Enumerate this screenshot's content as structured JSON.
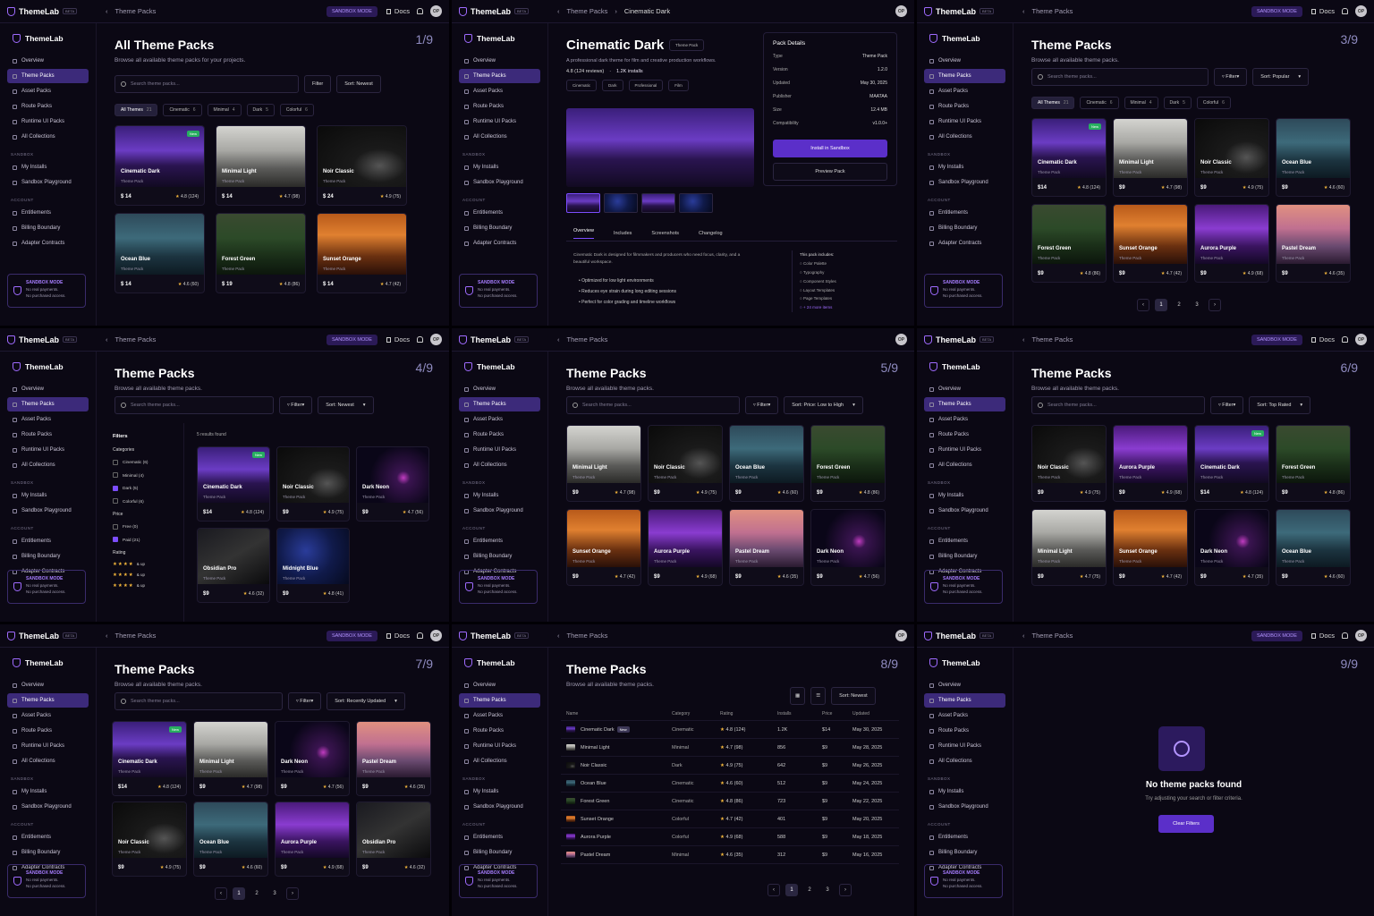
{
  "app": {
    "name": "ThemeLab",
    "beta": "BETA",
    "sandbox_mode": "SANDBOX MODE",
    "docs": "Docs",
    "avatar": "OP",
    "crumb_theme_packs": "Theme Packs",
    "crumb_detail": "Cinematic Dark"
  },
  "sidebar": {
    "overview": "Overview",
    "theme_packs": "Theme Packs",
    "asset_packs": "Asset Packs",
    "route_packs": "Route Packs",
    "runtime_ui": "Runtime UI Packs",
    "all_collections": "All Collections",
    "sandbox_section": "SANDBOX",
    "my_installs": "My Installs",
    "sandbox_playground": "Sandbox Playground",
    "account_section": "ACCOUNT",
    "entitlements": "Entitlements",
    "billing": "Billing Boundary",
    "adapters": "Adapter Contracts",
    "card_title": "SANDBOX MODE",
    "card_line1": "No real payments.",
    "card_line2": "No purchased access."
  },
  "colors": {
    "accent": "#7c4dff",
    "bg": "#0b0814",
    "star": "#f5b73b"
  },
  "p1": {
    "num": "1/9",
    "title": "All Theme Packs",
    "sub": "Browse all available theme packs for your projects.",
    "search": "Search theme packs...",
    "filter": "Filter",
    "sort": "Sort: Newest",
    "chips": [
      {
        "l": "All Themes",
        "c": "21"
      },
      {
        "l": "Cinematic",
        "c": "6"
      },
      {
        "l": "Minimal",
        "c": "4"
      },
      {
        "l": "Dark",
        "c": "5"
      },
      {
        "l": "Colorful",
        "c": "6"
      }
    ],
    "cards": [
      {
        "t": "Cinematic Dark",
        "tp": "Theme Pack",
        "p": "$ 14",
        "r": "4.8 (124)",
        "n": "New"
      },
      {
        "t": "Minimal Light",
        "tp": "Theme Pack",
        "p": "$ 14",
        "r": "4.7 (98)"
      },
      {
        "t": "Noir Classic",
        "tp": "Theme Pack",
        "p": "$ 24",
        "r": "4.9 (75)"
      },
      {
        "t": "Ocean Blue",
        "tp": "Theme Pack",
        "p": "$ 14",
        "r": "4.6 (60)"
      },
      {
        "t": "Forest Green",
        "tp": "Theme Pack",
        "p": "$ 19",
        "r": "4.8 (86)"
      },
      {
        "t": "Sunset Orange",
        "tp": "Theme Pack",
        "p": "$ 14",
        "r": "4.7 (42)"
      }
    ]
  },
  "p2": {
    "title": "Cinematic Dark",
    "badge": "Theme Pack",
    "desc": "A professional dark theme for film and creative production workflows.",
    "rating": "4.8 (124 reviews)",
    "installs": "1.2K installs",
    "tags": [
      "Cinematic",
      "Dark",
      "Professional",
      "Film"
    ],
    "details_title": "Pack Details",
    "details": [
      {
        "k": "Type",
        "v": "Theme Pack"
      },
      {
        "k": "Version",
        "v": "1.2.0"
      },
      {
        "k": "Updated",
        "v": "May 30, 2025"
      },
      {
        "k": "Publisher",
        "v": "MAATAA"
      },
      {
        "k": "Size",
        "v": "12.4 MB"
      },
      {
        "k": "Compatibility",
        "v": "v1.0.0+"
      }
    ],
    "install": "Install in Sandbox",
    "preview": "Preview Pack",
    "tabs": [
      "Overview",
      "Includes",
      "Screenshots",
      "Changelog"
    ],
    "overview": "Cinematic Dark is designed for filmmakers and producers who need focus, clarity, and a beautiful workspace.",
    "bullets": [
      "Optimized for low light environments",
      "Reduces eye strain during long editing sessions",
      "Perfect for color grading and timeline workflows"
    ],
    "incl_title": "This pack includes:",
    "incl": [
      "Color Palette",
      "Typography",
      "Component Styles",
      "Layout Templates",
      "Page Templates",
      "+ 24 more items"
    ]
  },
  "p3": {
    "num": "3/9",
    "title": "Theme Packs",
    "sub": "Browse all available theme packs.",
    "sort": "Sort: Popular",
    "chips": [
      {
        "l": "All Themes",
        "c": "21"
      },
      {
        "l": "Cinematic",
        "c": "6"
      },
      {
        "l": "Minimal",
        "c": "4"
      },
      {
        "l": "Dark",
        "c": "5"
      },
      {
        "l": "Colorful",
        "c": "6"
      }
    ],
    "cards": [
      {
        "t": "Cinematic Dark",
        "tp": "Theme Pack",
        "p": "$14",
        "r": "4.8 (124)",
        "n": "New"
      },
      {
        "t": "Minimal Light",
        "tp": "Theme Pack",
        "p": "$9",
        "r": "4.7 (98)"
      },
      {
        "t": "Noir Classic",
        "tp": "Theme Pack",
        "p": "$9",
        "r": "4.9 (75)"
      },
      {
        "t": "Ocean Blue",
        "tp": "Theme Pack",
        "p": "$9",
        "r": "4.6 (60)"
      },
      {
        "t": "Forest Green",
        "tp": "Theme Pack",
        "p": "$9",
        "r": "4.8 (86)"
      },
      {
        "t": "Sunset Orange",
        "tp": "Theme Pack",
        "p": "$9",
        "r": "4.7 (42)"
      },
      {
        "t": "Aurora Purple",
        "tp": "Theme Pack",
        "p": "$9",
        "r": "4.9 (68)"
      },
      {
        "t": "Pastel Dream",
        "tp": "Theme Pack",
        "p": "$9",
        "r": "4.6 (35)"
      }
    ],
    "pages": [
      "1",
      "2",
      "3"
    ]
  },
  "p4": {
    "num": "4/9",
    "sort": "Sort: Newest",
    "filters": "Filters",
    "results": "5 results found",
    "cat_title": "Categories",
    "cats": [
      {
        "l": "Cinematic (6)",
        "on": false
      },
      {
        "l": "Minimal (4)",
        "on": false
      },
      {
        "l": "Dark (5)",
        "on": true
      },
      {
        "l": "Colorful (6)",
        "on": false
      }
    ],
    "price_title": "Price",
    "prices": [
      {
        "l": "Free (0)",
        "on": false
      },
      {
        "l": "Paid (21)",
        "on": true
      }
    ],
    "rating_title": "Rating",
    "up": "& up",
    "cards": [
      {
        "t": "Cinematic Dark",
        "tp": "Theme Pack",
        "p": "$14",
        "r": "4.8 (124)",
        "n": "New"
      },
      {
        "t": "Noir Classic",
        "tp": "Theme Pack",
        "p": "$9",
        "r": "4.9 (75)"
      },
      {
        "t": "Dark Neon",
        "tp": "Theme Pack",
        "p": "$9",
        "r": "4.7 (56)"
      },
      {
        "t": "Obsidian Pro",
        "tp": "Theme Pack",
        "p": "$9",
        "r": "4.6 (32)"
      },
      {
        "t": "Midnight Blue",
        "tp": "Theme Pack",
        "p": "$9",
        "r": "4.8 (41)"
      }
    ]
  },
  "p5": {
    "num": "5/9",
    "sort": "Sort: Price: Low to High",
    "cards": [
      {
        "t": "Minimal Light",
        "tp": "Theme Pack",
        "p": "$9",
        "r": "4.7 (98)"
      },
      {
        "t": "Noir Classic",
        "tp": "Theme Pack",
        "p": "$9",
        "r": "4.9 (75)"
      },
      {
        "t": "Ocean Blue",
        "tp": "Theme Pack",
        "p": "$9",
        "r": "4.6 (60)"
      },
      {
        "t": "Forest Green",
        "tp": "Theme Pack",
        "p": "$9",
        "r": "4.8 (86)"
      },
      {
        "t": "Sunset Orange",
        "tp": "Theme Pack",
        "p": "$9",
        "r": "4.7 (42)"
      },
      {
        "t": "Aurora Purple",
        "tp": "Theme Pack",
        "p": "$9",
        "r": "4.9 (68)"
      },
      {
        "t": "Pastel Dream",
        "tp": "Theme Pack",
        "p": "$9",
        "r": "4.6 (35)"
      },
      {
        "t": "Dark Neon",
        "tp": "Theme Pack",
        "p": "$9",
        "r": "4.7 (56)"
      }
    ]
  },
  "p6": {
    "num": "6/9",
    "sort": "Sort: Top Rated",
    "cards": [
      {
        "t": "Noir Classic",
        "tp": "Theme Pack",
        "p": "$9",
        "r": "4.9 (75)"
      },
      {
        "t": "Aurora Purple",
        "tp": "Theme Pack",
        "p": "$9",
        "r": "4.9 (68)"
      },
      {
        "t": "Cinematic Dark",
        "tp": "Theme Pack",
        "p": "$14",
        "r": "4.8 (124)",
        "n": "New"
      },
      {
        "t": "Forest Green",
        "tp": "Theme Pack",
        "p": "$9",
        "r": "4.8 (86)"
      },
      {
        "t": "Minimal Light",
        "tp": "Theme Pack",
        "p": "$9",
        "r": "4.7 (75)"
      },
      {
        "t": "Sunset Orange",
        "tp": "Theme Pack",
        "p": "$9",
        "r": "4.7 (42)"
      },
      {
        "t": "Dark Neon",
        "tp": "Theme Pack",
        "p": "$9",
        "r": "4.7 (35)"
      },
      {
        "t": "Ocean Blue",
        "tp": "Theme Pack",
        "p": "$9",
        "r": "4.6 (60)"
      }
    ]
  },
  "p7": {
    "num": "7/9",
    "sort": "Sort: Recently Updated",
    "cards": [
      {
        "t": "Cinematic Dark",
        "tp": "Theme Pack",
        "p": "$14",
        "r": "4.8 (124)",
        "n": "New"
      },
      {
        "t": "Minimal Light",
        "tp": "Theme Pack",
        "p": "$9",
        "r": "4.7 (98)"
      },
      {
        "t": "Dark Neon",
        "tp": "Theme Pack",
        "p": "$9",
        "r": "4.7 (56)"
      },
      {
        "t": "Pastel Dream",
        "tp": "Theme Pack",
        "p": "$9",
        "r": "4.6 (35)"
      },
      {
        "t": "Noir Classic",
        "tp": "Theme Pack",
        "p": "$9",
        "r": "4.9 (75)"
      },
      {
        "t": "Ocean Blue",
        "tp": "Theme Pack",
        "p": "$9",
        "r": "4.6 (60)"
      },
      {
        "t": "Aurora Purple",
        "tp": "Theme Pack",
        "p": "$9",
        "r": "4.9 (68)"
      },
      {
        "t": "Obsidian Pro",
        "tp": "Theme Pack",
        "p": "$9",
        "r": "4.6 (32)"
      }
    ]
  },
  "p8": {
    "num": "8/9",
    "sort": "Sort: Newest",
    "cols": [
      "Name",
      "Category",
      "Rating",
      "Installs",
      "Price",
      "Updated"
    ],
    "rows": [
      {
        "n": "Cinematic Dark",
        "new": "New",
        "c": "Cinematic",
        "r": "4.8 (124)",
        "i": "1.2K",
        "p": "$14",
        "u": "May 30, 2025"
      },
      {
        "n": "Minimal Light",
        "c": "Minimal",
        "r": "4.7 (98)",
        "i": "856",
        "p": "$9",
        "u": "May 28, 2025"
      },
      {
        "n": "Noir Classic",
        "c": "Dark",
        "r": "4.9 (75)",
        "i": "642",
        "p": "$9",
        "u": "May 26, 2025"
      },
      {
        "n": "Ocean Blue",
        "c": "Cinematic",
        "r": "4.6 (60)",
        "i": "512",
        "p": "$9",
        "u": "May 24, 2025"
      },
      {
        "n": "Forest Green",
        "c": "Cinematic",
        "r": "4.8 (86)",
        "i": "723",
        "p": "$9",
        "u": "May 22, 2025"
      },
      {
        "n": "Sunset Orange",
        "c": "Colorful",
        "r": "4.7 (42)",
        "i": "401",
        "p": "$9",
        "u": "May 20, 2025"
      },
      {
        "n": "Aurora Purple",
        "c": "Colorful",
        "r": "4.9 (68)",
        "i": "588",
        "p": "$9",
        "u": "May 18, 2025"
      },
      {
        "n": "Pastel Dream",
        "c": "Minimal",
        "r": "4.6 (35)",
        "i": "312",
        "p": "$9",
        "u": "May 16, 2025"
      }
    ]
  },
  "p9": {
    "num": "9/9",
    "empty_title": "No theme packs found",
    "empty_sub": "Try adjusting your search or filter criteria.",
    "clear": "Clear Filters"
  }
}
